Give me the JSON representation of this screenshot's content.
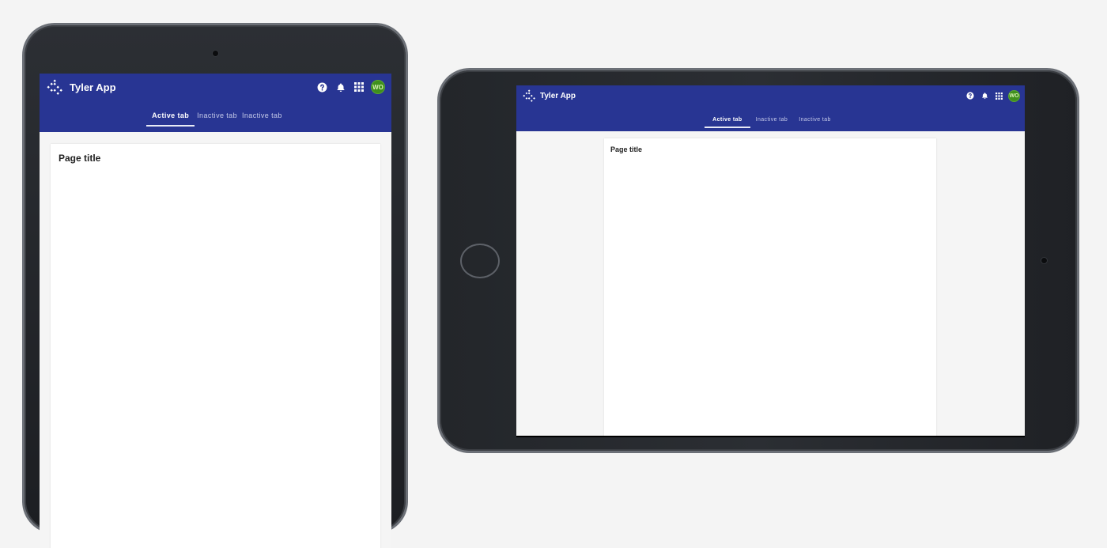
{
  "app": {
    "title": "Tyler App",
    "user_initials": "WO",
    "brand_color": "#283593",
    "avatar_color": "#3f8f1c",
    "icons": [
      "tyler-logo-icon",
      "help-icon",
      "notifications-icon",
      "apps-grid-icon"
    ]
  },
  "tabs": [
    {
      "label": "Active tab",
      "active": true
    },
    {
      "label": "Inactive tab",
      "active": false
    },
    {
      "label": "Inactive tab",
      "active": false
    }
  ],
  "page": {
    "title": "Page title"
  }
}
